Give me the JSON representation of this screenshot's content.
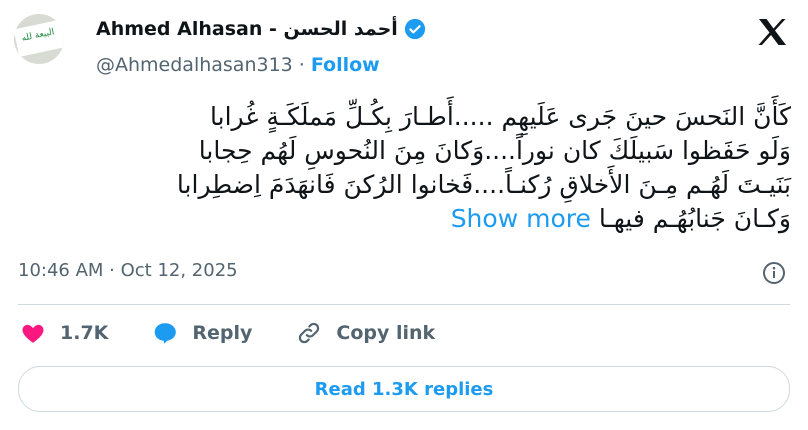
{
  "author": {
    "name": "Ahmed Alhasan - أحمد الحسن",
    "handle": "@Ahmedalhasan313",
    "follow_label": "Follow",
    "avatar_text": "البيعة لله"
  },
  "post": {
    "lines": [
      "كَأَنَّ النَحسَ حينَ جَرى عَلَيهِم .....أَطـارَ بِكُـلِّ مَملَكَـةٍ غُرابا",
      "وَلَو حَفَظوا سَبيلَكَ كان نوراً....وَكانَ مِنَ النُحوسِ لَهُم حِجابا",
      "بَنَيـتَ لَهُـم مِـنَ الأَخلاقِ رُكنـاً....فَخانوا الرُكنَ فَانهَدَمَ اِضطِرابا",
      "وَكـانَ جَنابُهُـم فيهـا"
    ],
    "show_more": "Show more",
    "timestamp": "10:46 AM · Oct 12, 2025"
  },
  "actions": {
    "likes": "1.7K",
    "reply": "Reply",
    "copy_link": "Copy link"
  },
  "read_replies": "Read 1.3K replies",
  "colors": {
    "accent": "#1d9bf0",
    "like": "#f91880",
    "muted": "#536471",
    "border": "#cfd9de"
  }
}
